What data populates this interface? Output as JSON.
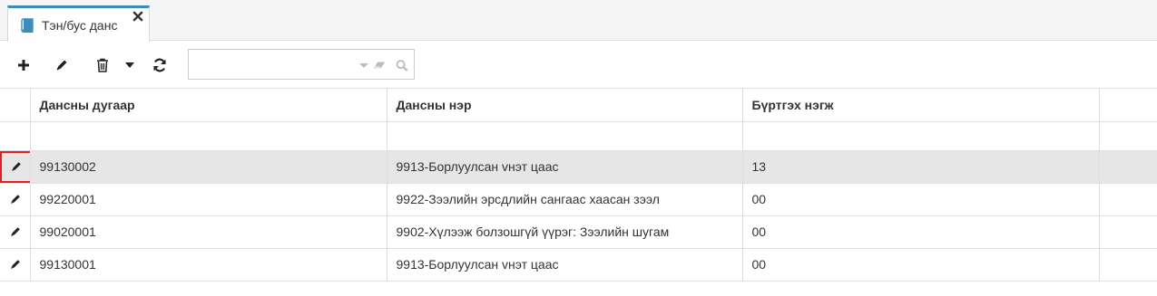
{
  "tab": {
    "label": "Тэн/бус данс",
    "icon": "book-icon",
    "close_icon": "close-icon",
    "accent_color": "#3c8dbc"
  },
  "toolbar": {
    "buttons": [
      {
        "name": "add-button",
        "icon": "plus-icon"
      },
      {
        "name": "edit-button",
        "icon": "pencil-icon"
      },
      {
        "name": "delete-button",
        "icon": "trash-icon"
      },
      {
        "name": "delete-dropdown-button",
        "icon": "caret-down-icon"
      },
      {
        "name": "refresh-button",
        "icon": "refresh-icon"
      }
    ],
    "search": {
      "value": "",
      "placeholder": "",
      "icons": [
        "dropdown-icon",
        "eraser-icon",
        "search-icon"
      ]
    }
  },
  "table": {
    "columns": [
      "Дансны дугаар",
      "Дансны нэр",
      "Бүртгэх нэгж"
    ],
    "rows": [
      {
        "account_no": "99130002",
        "account_name": "9913-Борлуулсан vнэт цаас",
        "unit": "13",
        "selected": true
      },
      {
        "account_no": "99220001",
        "account_name": "9922-Зээлийн эрсдлийн сангаас хаасан зээл",
        "unit": "00",
        "selected": false
      },
      {
        "account_no": "99020001",
        "account_name": "9902-Хүлээж болзошгүй үүрэг: Зээлийн шугам",
        "unit": "00",
        "selected": false
      },
      {
        "account_no": "99130001",
        "account_name": "9913-Борлуулсан vнэт цаас",
        "unit": "00",
        "selected": false
      }
    ],
    "selected_row_color": "#e6e6e6",
    "highlight_color": "#e0221e"
  }
}
